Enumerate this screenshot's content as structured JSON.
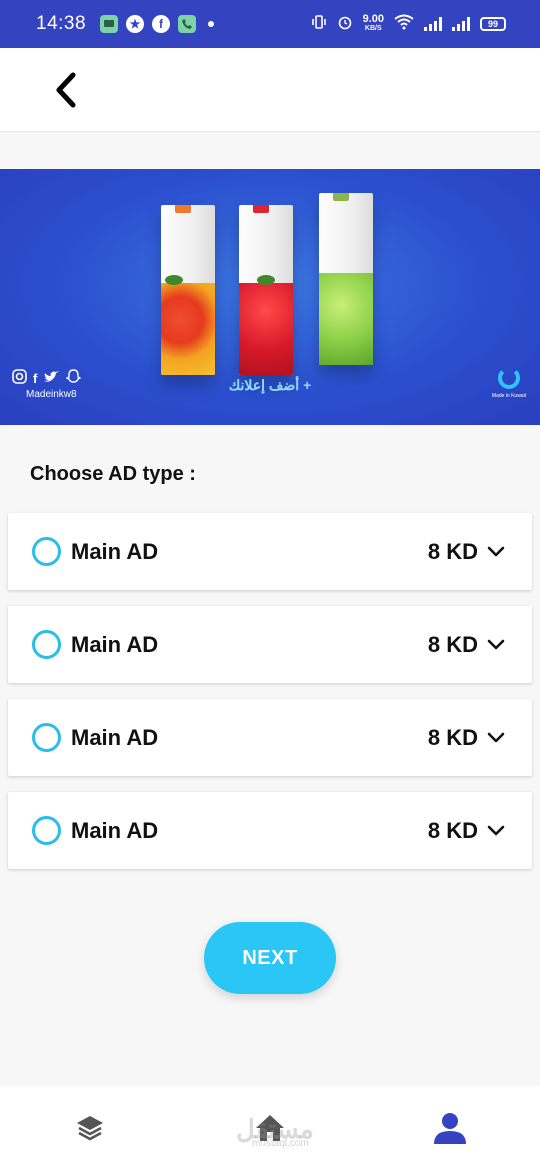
{
  "status_bar": {
    "time": "14:38",
    "net_speed_value": "9.00",
    "net_speed_unit": "KB/S",
    "battery": "99"
  },
  "header": {
    "back_icon": "chevron-left-icon"
  },
  "banner": {
    "social_handle": "Madeinkw8",
    "cta_text": "+ أضف إعلانك",
    "brand_text": "Made in Kuwait",
    "social_icons": [
      "instagram-icon",
      "facebook-icon",
      "twitter-icon",
      "snapchat-icon"
    ]
  },
  "section": {
    "title": "Choose AD type :"
  },
  "options": [
    {
      "label": "Main AD",
      "price": "8 KD"
    },
    {
      "label": "Main AD",
      "price": "8 KD"
    },
    {
      "label": "Main AD",
      "price": "8 KD"
    },
    {
      "label": "Main AD",
      "price": "8 KD"
    }
  ],
  "actions": {
    "next_label": "NEXT"
  },
  "bottom_nav": {
    "items": [
      "layers-icon",
      "home-icon",
      "profile-icon"
    ],
    "watermark": "مستقل",
    "watermark_sub": "mostaql.com"
  },
  "colors": {
    "status_bar": "#3443c0",
    "accent": "#29c6f6",
    "radio": "#29bde8",
    "nav_active": "#3443c0",
    "nav_inactive": "#555555"
  }
}
